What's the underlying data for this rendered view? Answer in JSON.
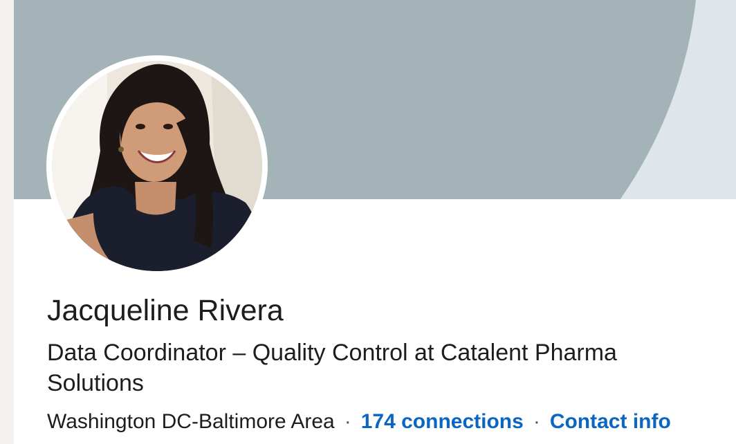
{
  "profile": {
    "name": "Jacqueline Rivera",
    "headline": "Data Coordinator – Quality Control at Catalent Pharma Solutions",
    "location": "Washington DC-Baltimore Area",
    "separator": "·",
    "connections_label": "174 connections",
    "contact_info_label": "Contact info"
  },
  "colors": {
    "cover_background": "#dfe6e9",
    "cover_shape": "#a3b3b7",
    "link": "#0a66c2",
    "text": "#1d1d1d"
  }
}
